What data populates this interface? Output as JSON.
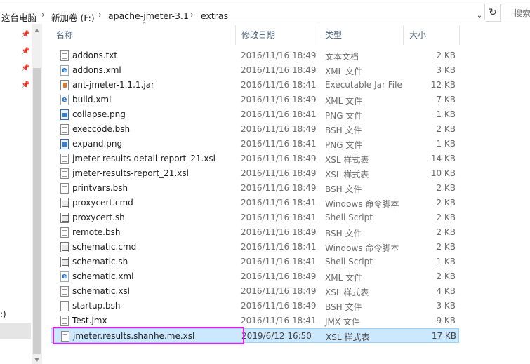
{
  "breadcrumb": {
    "items": [
      "这台电脑",
      "新加卷 (F:)",
      "apache-jmeter-3.1",
      "extras"
    ]
  },
  "search": {
    "placeholder": "搜索"
  },
  "nav": {
    "partial_label": ":)"
  },
  "columns": {
    "name": "名称",
    "date": "修改日期",
    "type": "类型",
    "size": "大小"
  },
  "files": [
    {
      "name": "addons.txt",
      "date": "2016/11/16 18:49",
      "type": "文本文档",
      "size": "2 KB",
      "icon": "txt"
    },
    {
      "name": "addons.xml",
      "date": "2016/11/16 18:49",
      "type": "XML 文件",
      "size": "3 KB",
      "icon": "ie"
    },
    {
      "name": "ant-jmeter-1.1.1.jar",
      "date": "2016/11/16 18:41",
      "type": "Executable Jar File",
      "size": "12 KB",
      "icon": "jar"
    },
    {
      "name": "build.xml",
      "date": "2016/11/16 18:49",
      "type": "XML 文件",
      "size": "7 KB",
      "icon": "ie"
    },
    {
      "name": "collapse.png",
      "date": "2016/11/16 18:41",
      "type": "PNG 文件",
      "size": "1 KB",
      "icon": "png"
    },
    {
      "name": "execcode.bsh",
      "date": "2016/11/16 18:49",
      "type": "BSH 文件",
      "size": "2 KB",
      "icon": "txt"
    },
    {
      "name": "expand.png",
      "date": "2016/11/16 18:41",
      "type": "PNG 文件",
      "size": "1 KB",
      "icon": "png"
    },
    {
      "name": "jmeter-results-detail-report_21.xsl",
      "date": "2016/11/16 18:49",
      "type": "XSL 样式表",
      "size": "14 KB",
      "icon": "txt"
    },
    {
      "name": "jmeter-results-report_21.xsl",
      "date": "2016/11/16 18:49",
      "type": "XSL 样式表",
      "size": "10 KB",
      "icon": "txt"
    },
    {
      "name": "printvars.bsh",
      "date": "2016/11/16 18:49",
      "type": "BSH 文件",
      "size": "2 KB",
      "icon": "txt"
    },
    {
      "name": "proxycert.cmd",
      "date": "2016/11/16 18:41",
      "type": "Windows 命令脚本",
      "size": "2 KB",
      "icon": "cmd"
    },
    {
      "name": "proxycert.sh",
      "date": "2016/11/16 18:41",
      "type": "Shell Script",
      "size": "2 KB",
      "icon": "cmd"
    },
    {
      "name": "remote.bsh",
      "date": "2016/11/16 18:49",
      "type": "BSH 文件",
      "size": "2 KB",
      "icon": "txt"
    },
    {
      "name": "schematic.cmd",
      "date": "2016/11/16 18:41",
      "type": "Windows 命令脚本",
      "size": "2 KB",
      "icon": "cmd"
    },
    {
      "name": "schematic.sh",
      "date": "2016/11/16 18:41",
      "type": "Shell Script",
      "size": "1 KB",
      "icon": "cmd"
    },
    {
      "name": "schematic.xml",
      "date": "2016/11/16 18:49",
      "type": "XML 文件",
      "size": "2 KB",
      "icon": "ie"
    },
    {
      "name": "schematic.xsl",
      "date": "2016/11/16 18:49",
      "type": "XSL 样式表",
      "size": "4 KB",
      "icon": "txt"
    },
    {
      "name": "startup.bsh",
      "date": "2016/11/16 18:49",
      "type": "BSH 文件",
      "size": "3 KB",
      "icon": "txt"
    },
    {
      "name": "Test.jmx",
      "date": "2016/11/16 18:41",
      "type": "JMX 文件",
      "size": "9 KB",
      "icon": "txt"
    },
    {
      "name": "jmeter.results.shanhe.me.xsl",
      "date": "2019/6/12 16:50",
      "type": "XSL 样式表",
      "size": "17 KB",
      "icon": "txt",
      "selected": true
    }
  ],
  "colors": {
    "selection_bg": "#cce8ff",
    "selection_border": "#99d1ff",
    "annotation": "#e51ee5"
  }
}
